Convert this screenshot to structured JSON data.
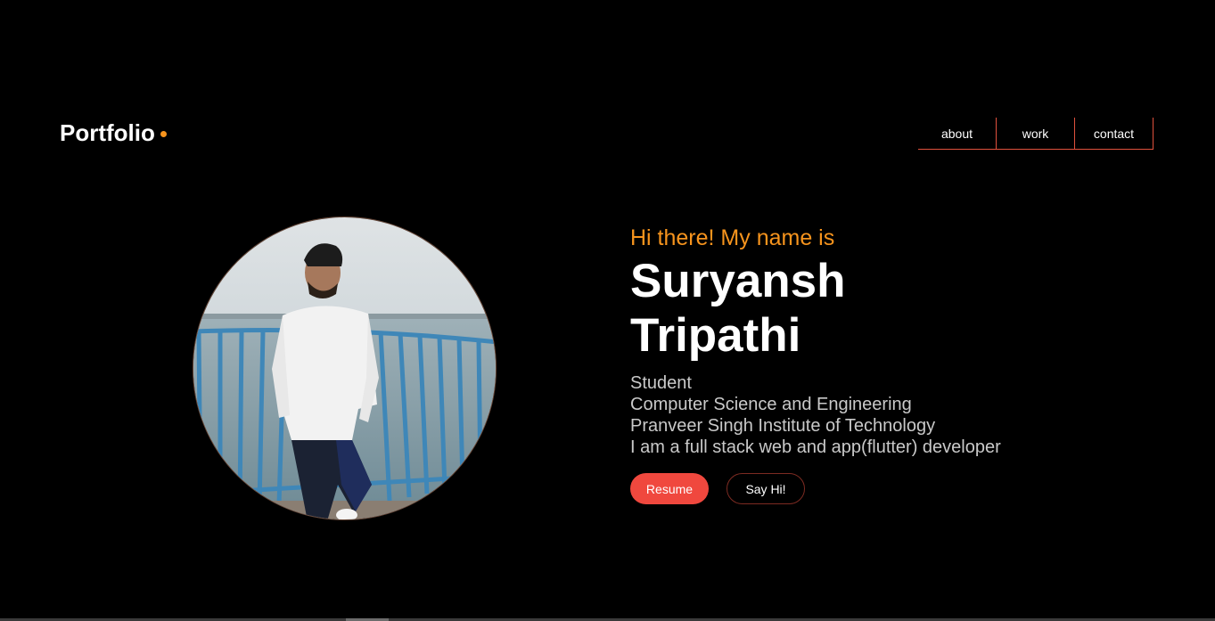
{
  "colors": {
    "accent": "#f7941d",
    "accent2": "#e0513d",
    "primary_button": "#f0483e",
    "outline_border": "#7d2b22"
  },
  "header": {
    "brand": "Portfolio",
    "nav": [
      {
        "label": "about"
      },
      {
        "label": "work"
      },
      {
        "label": "contact"
      }
    ]
  },
  "hero": {
    "greeting": "Hi there! My name is",
    "name_line1": "Suryansh",
    "name_line2": "Tripathi",
    "description": [
      "Student",
      "Computer Science and Engineering",
      "Pranveer Singh Institute of Technology",
      "I am a full stack web and app(flutter) developer"
    ],
    "resume_label": "Resume",
    "sayhi_label": "Say Hi!"
  }
}
